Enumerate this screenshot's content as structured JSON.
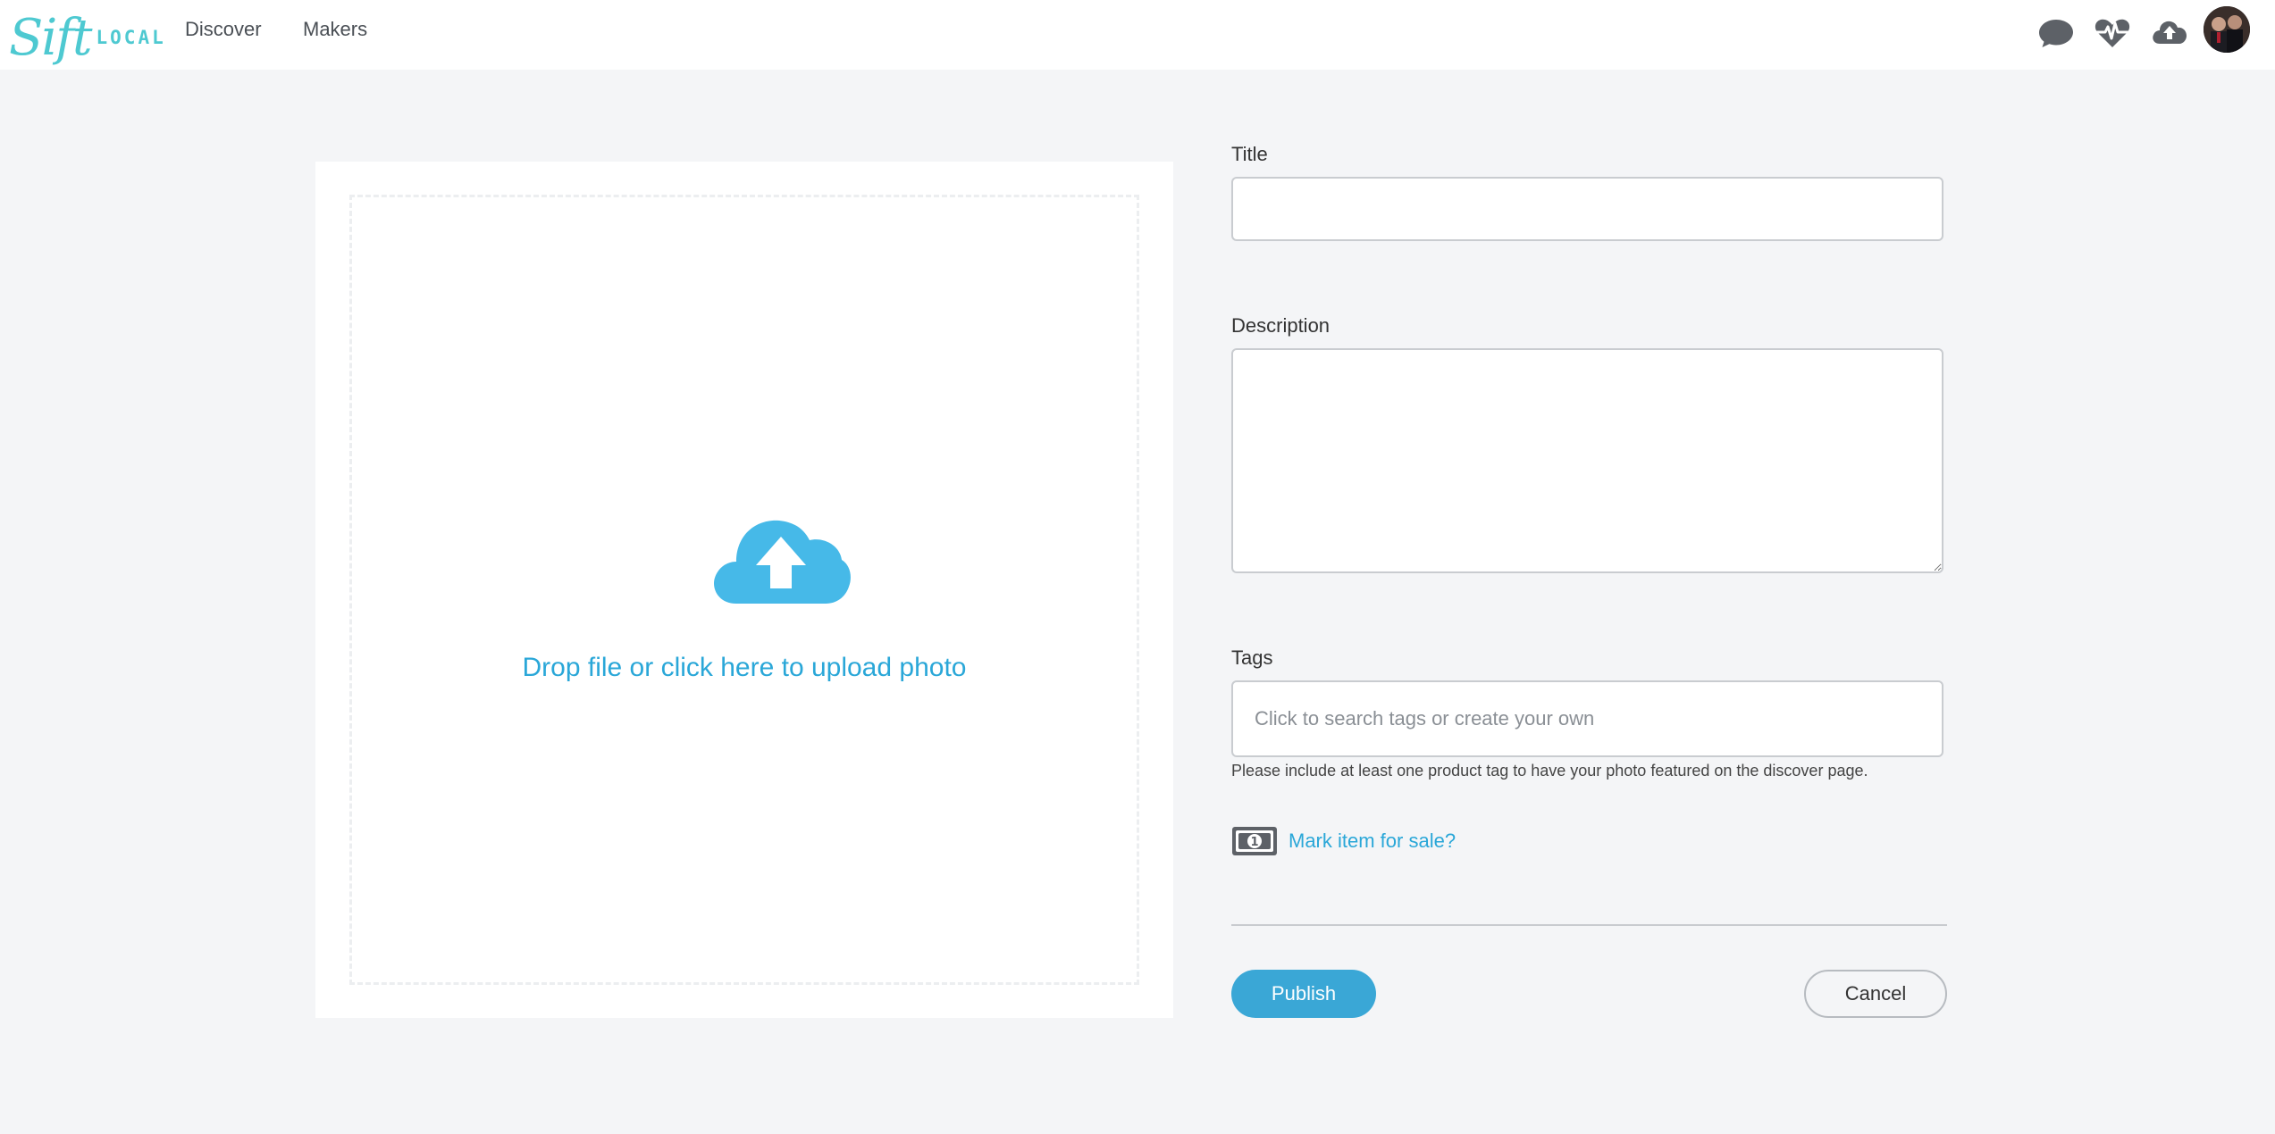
{
  "brand": {
    "logo_script": "Sift",
    "logo_word": "LOCAL",
    "accent_color": "#4ec9d1"
  },
  "nav": {
    "links": [
      {
        "label": "Discover"
      },
      {
        "label": "Makers"
      }
    ],
    "icons": [
      "chat-bubble-icon",
      "heart-pulse-icon",
      "cloud-upload-icon"
    ]
  },
  "upload": {
    "prompt": "Drop file or click here to upload photo",
    "icon": "cloud-upload-icon",
    "color": "#2aa7d8"
  },
  "form": {
    "title_label": "Title",
    "title_value": "",
    "description_label": "Description",
    "description_value": "",
    "tags_label": "Tags",
    "tags_value": "",
    "tags_placeholder": "Click to search tags or create your own",
    "tags_help": "Please include at least one product tag to have your photo featured on the discover page.",
    "sale_icon": "dollar-bill-icon",
    "sale_link": "Mark item for sale?",
    "publish_label": "Publish",
    "cancel_label": "Cancel",
    "publish_color": "#3aa7d6"
  }
}
